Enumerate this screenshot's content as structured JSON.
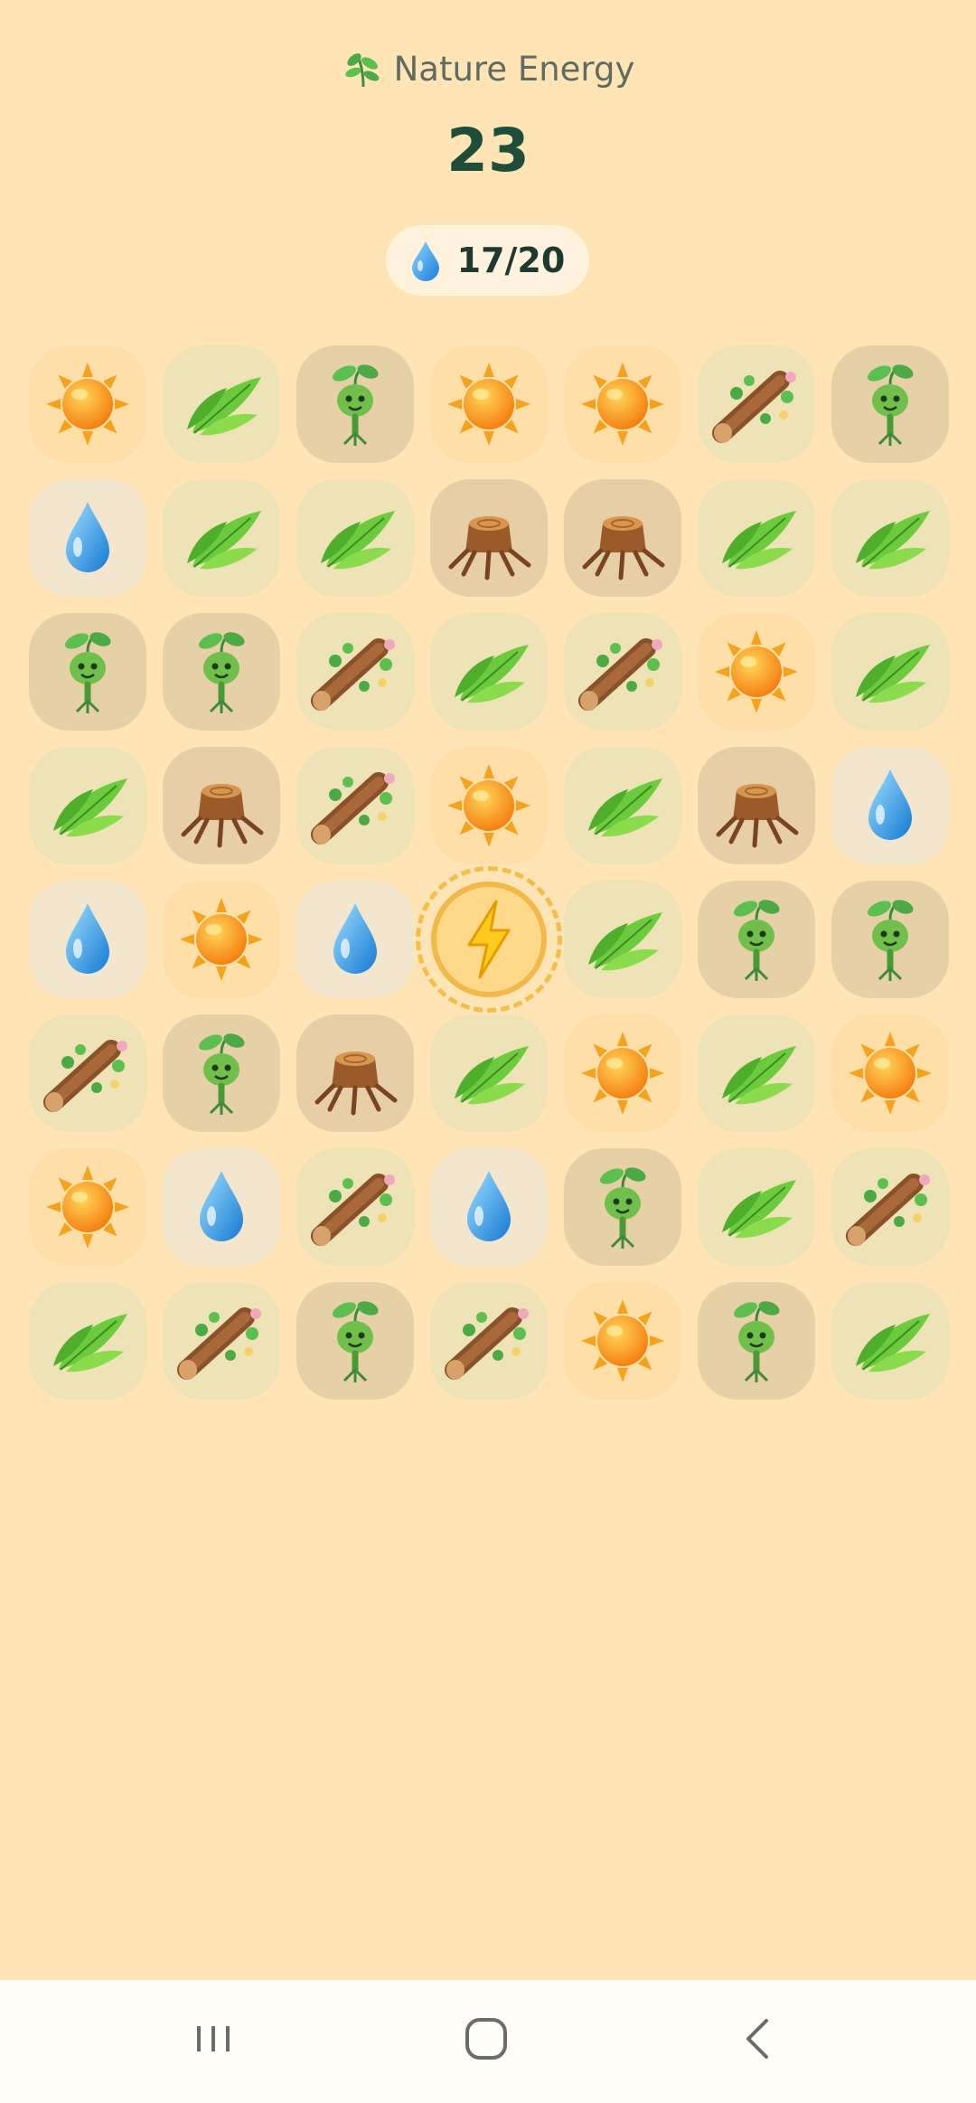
{
  "header": {
    "title": "Nature Energy",
    "title_icon": "herb-icon",
    "score": "23"
  },
  "moves": {
    "icon": "water-drop-icon",
    "label": "17/20"
  },
  "board": {
    "columns": 7,
    "rows": [
      [
        "sun",
        "leaf",
        "sprout",
        "sun",
        "sun",
        "branch",
        "sprout"
      ],
      [
        "water",
        "leaf",
        "leaf",
        "stump",
        "stump",
        "leaf",
        "leaf"
      ],
      [
        "sprout",
        "sprout",
        "branch",
        "leaf",
        "branch",
        "sun",
        "leaf"
      ],
      [
        "leaf",
        "stump",
        "branch",
        "sun",
        "leaf",
        "stump",
        "water"
      ],
      [
        "water",
        "sun",
        "water",
        "energy",
        "leaf",
        "sprout",
        "sprout"
      ],
      [
        "branch",
        "sprout",
        "stump",
        "leaf",
        "sun",
        "leaf",
        "sun"
      ],
      [
        "sun",
        "water",
        "branch",
        "water",
        "sprout",
        "leaf",
        "branch"
      ],
      [
        "leaf",
        "branch",
        "sprout",
        "branch",
        "sun",
        "sprout",
        "leaf"
      ]
    ]
  },
  "navbar": {
    "recent_icon": "recent-apps-icon",
    "home_icon": "home-icon",
    "back_icon": "back-icon"
  },
  "colors": {
    "background": "#FFE4B5",
    "score": "#1e4d3a",
    "energy_ring": "#F5BE4A"
  }
}
